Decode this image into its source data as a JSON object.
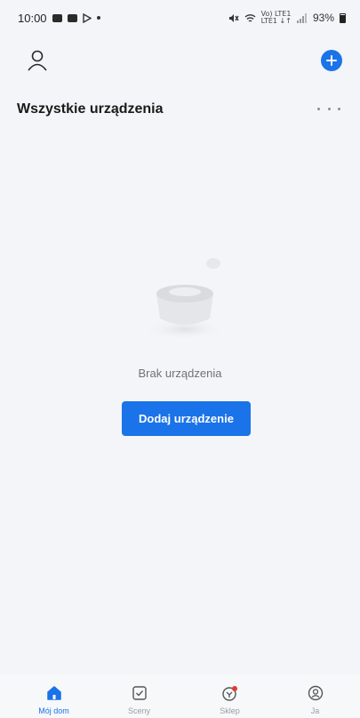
{
  "status_bar": {
    "time": "10:00",
    "network_small_top": "Vo) LTE1",
    "network_small_bottom": "LTE1 ↓↑",
    "battery": "93%"
  },
  "header": {
    "title": "Wszystkie urządzenia"
  },
  "empty_state": {
    "message": "Brak urządzenia",
    "button_label": "Dodaj urządzenie"
  },
  "tabbar": {
    "tabs": [
      {
        "label": "Mój dom",
        "icon": "home-icon",
        "active": true
      },
      {
        "label": "Sceny",
        "icon": "scenes-icon",
        "active": false
      },
      {
        "label": "Sklep",
        "icon": "store-icon",
        "active": false
      },
      {
        "label": "Ja",
        "icon": "profile-icon",
        "active": false
      }
    ]
  },
  "colors": {
    "accent": "#1a73e8",
    "background": "#f3f5f8",
    "notification_dot": "#e53935"
  }
}
